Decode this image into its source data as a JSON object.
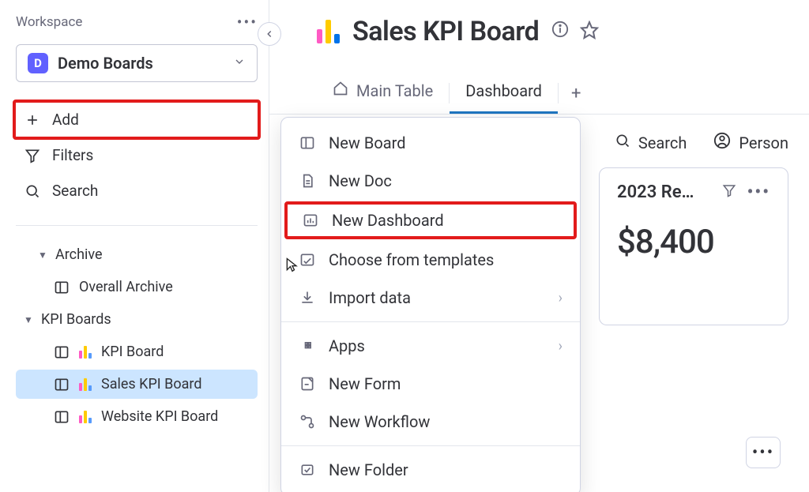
{
  "sidebar": {
    "workspace_label": "Workspace",
    "workspace_chip": "D",
    "workspace_name": "Demo Boards",
    "add_label": "Add",
    "filters_label": "Filters",
    "search_label": "Search",
    "tree": {
      "archive": {
        "label": "Archive",
        "items": [
          {
            "label": "Overall Archive"
          }
        ]
      },
      "kpi_boards": {
        "label": "KPI Boards",
        "items": [
          {
            "label": "KPI Board"
          },
          {
            "label": "Sales KPI Board",
            "active": true
          },
          {
            "label": "Website KPI Board"
          }
        ]
      }
    }
  },
  "header": {
    "title": "Sales KPI Board",
    "tabs": [
      {
        "label": "Main Table",
        "icon": "home-icon"
      },
      {
        "label": "Dashboard",
        "active": true
      }
    ]
  },
  "toolbar": {
    "search_label": "Search",
    "person_label": "Person"
  },
  "menu": {
    "items": [
      {
        "icon": "board-icon",
        "label": "New Board"
      },
      {
        "icon": "doc-icon",
        "label": "New Doc"
      },
      {
        "icon": "dashboard-icon",
        "label": "New Dashboard",
        "highlight": true
      },
      {
        "icon": "template-icon",
        "label": "Choose from templates"
      },
      {
        "icon": "import-icon",
        "label": "Import data",
        "arrow": true
      },
      {
        "sep": true
      },
      {
        "icon": "apps-icon",
        "label": "Apps",
        "arrow": true
      },
      {
        "icon": "form-icon",
        "label": "New Form"
      },
      {
        "icon": "workflow-icon",
        "label": "New Workflow"
      },
      {
        "sep": true
      },
      {
        "icon": "folder-icon",
        "label": "New Folder"
      }
    ]
  },
  "cards": [
    {
      "title": "2023 Re…",
      "value": "$8,400"
    }
  ],
  "colors": {
    "bar_pink": "#ff5ac4",
    "bar_yellow": "#ffcb00",
    "bar_blue": "#579bfc",
    "bar_darkblue": "#0073ea"
  }
}
